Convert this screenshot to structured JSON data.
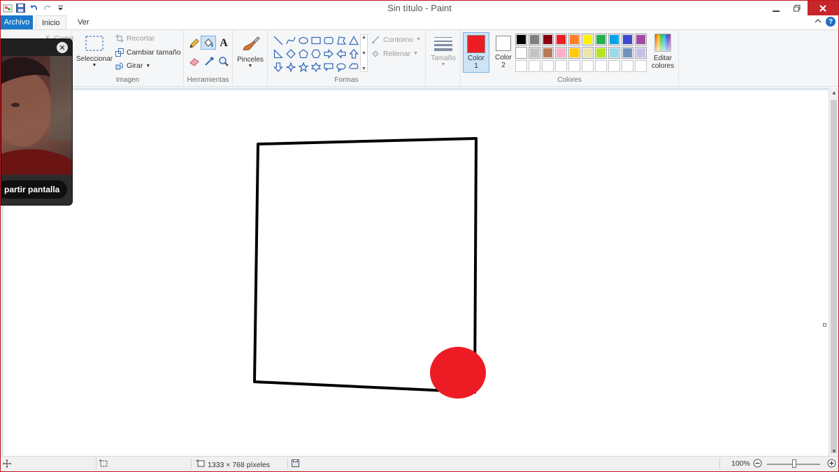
{
  "window": {
    "title": "Sin título - Paint"
  },
  "tabs": {
    "file": "Archivo",
    "home": "Inicio",
    "view": "Ver"
  },
  "clipboard": {
    "cut_partial": "Cortar"
  },
  "image_group": {
    "select": "Seleccionar",
    "crop": "Recortar",
    "resize": "Cambiar tamaño",
    "rotate": "Girar",
    "label": "Imagen"
  },
  "tools_group": {
    "label": "Herramientas"
  },
  "brushes_group": {
    "label": "Pinceles"
  },
  "shapes_group": {
    "outline": "Contorno",
    "fill": "Rellenar",
    "label": "Formas"
  },
  "size_group": {
    "label": "Tamaño"
  },
  "colors_group": {
    "color1_line1": "Color",
    "color1_line2": "1",
    "color2_line1": "Color",
    "color2_line2": "2",
    "edit_line1": "Editar",
    "edit_line2": "colores",
    "label": "Colores",
    "color1": "#ed1c24",
    "color2": "#ffffff",
    "palette_row1": [
      "#000000",
      "#7f7f7f",
      "#880015",
      "#ed1c24",
      "#ff7f27",
      "#fff200",
      "#22b14c",
      "#00a2e8",
      "#3f48cc",
      "#a349a4"
    ],
    "palette_row2": [
      "#ffffff",
      "#c3c3c3",
      "#b97a57",
      "#ffaec9",
      "#ffc90e",
      "#efe4b0",
      "#b5e61d",
      "#99d9ea",
      "#7092be",
      "#c8bfe7"
    ]
  },
  "video_overlay": {
    "share_label": "partir pantalla"
  },
  "canvas": {
    "stroke_color": "#000000",
    "dot_color": "#ed1c24"
  },
  "statusbar": {
    "dimensions": "1333 × 768 píxeles",
    "zoom": "100%"
  }
}
